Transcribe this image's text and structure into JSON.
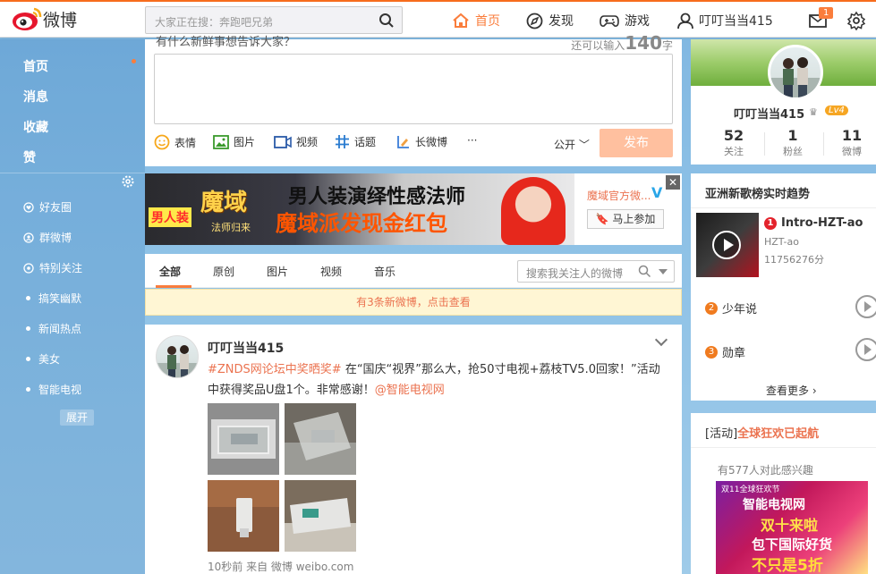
{
  "brand": {
    "name": "微博"
  },
  "search": {
    "placeholder": "大家正在搜：奔跑吧兄弟"
  },
  "nav": {
    "home": "首页",
    "discover": "发现",
    "game": "游戏",
    "user": "叮叮当当415",
    "msg_badge": "1"
  },
  "sidebar": {
    "main": [
      "首页",
      "消息",
      "收藏",
      "赞"
    ],
    "groups": [
      "好友圈",
      "群微博",
      "特别关注"
    ],
    "lists": [
      "搞笑幽默",
      "新闻热点",
      "美女",
      "智能电视"
    ],
    "expand": "展开"
  },
  "publisher": {
    "hint": "有什么新鲜事想告诉大家？",
    "count_prefix": "还可以输入",
    "count": "140",
    "count_suffix": "字",
    "tools": [
      "表情",
      "图片",
      "视频",
      "话题",
      "长微博",
      "···"
    ],
    "visibility": "公开",
    "submit": "发布"
  },
  "banner": {
    "tag": "男人装",
    "logo": "魔域",
    "logo_sub": "法师归来",
    "line1": "男人装演绎性感法师",
    "line2_a": "魔域派发",
    "line2_b": "现金红包",
    "side_text": "魔域官方微...",
    "join": "马上参加",
    "close": "✕"
  },
  "tabs": {
    "items": [
      "全部",
      "原创",
      "图片",
      "视频",
      "音乐"
    ],
    "search_placeholder": "搜索我关注人的微博",
    "new_notice": "有3条新微博，点击查看"
  },
  "post": {
    "author": "叮叮当当415",
    "topic": "#ZNDS网论坛中奖晒奖#",
    "body1": " 在“国庆“视界”那么大，抢50寸电视+荔枝TV5.0回家！”活动中获得奖品U盘1个。非常感谢！",
    "mention": "@智能电视网",
    "meta": "10秒前 来自 微博 weibo.com"
  },
  "profile": {
    "name": "叮叮当当415",
    "level": "Lv4",
    "stats": [
      {
        "n": "52",
        "label": "关注"
      },
      {
        "n": "1",
        "label": "粉丝"
      },
      {
        "n": "11",
        "label": "微博"
      }
    ]
  },
  "trend": {
    "title": "亚洲新歌榜实时趋势",
    "top": {
      "rank": "1",
      "song": "Intro-HZT-ao",
      "artist": "HZT-ao",
      "score": "11756276分"
    },
    "others": [
      {
        "rank": "2",
        "song": "少年说"
      },
      {
        "rank": "3",
        "song": "勋章"
      }
    ],
    "more": "查看更多 ›"
  },
  "activity": {
    "label": "[活动]",
    "title": "全球狂欢已起航",
    "sub": "有577人对此感兴趣",
    "img_t1": "双11全球狂欢节",
    "img_t2": "智能电视网",
    "img_t3": "双十来啦",
    "img_t4": "包下国际好货",
    "img_t5": "不只是5折"
  },
  "colors": {
    "accent": "#fa7d3c",
    "link": "#eb7350",
    "bg": "#8cc0e6"
  }
}
